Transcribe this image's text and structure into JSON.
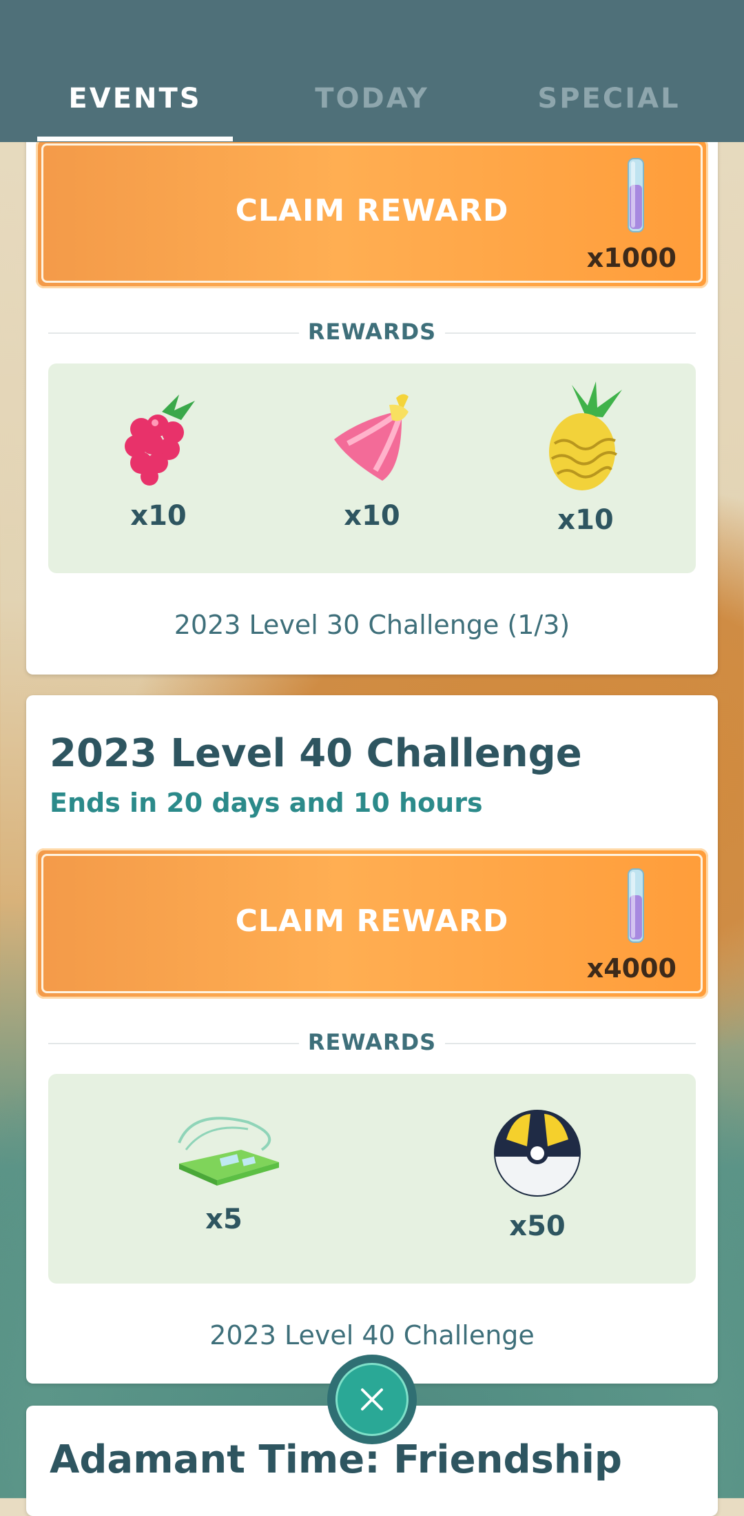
{
  "tabs": [
    {
      "label": "EVENTS",
      "active": true
    },
    {
      "label": "TODAY",
      "active": false
    },
    {
      "label": "SPECIAL",
      "active": false
    }
  ],
  "cards": [
    {
      "claim_label": "CLAIM REWARD",
      "claim_qty": "x1000",
      "rewards_heading": "REWARDS",
      "rewards": [
        {
          "icon": "razz-berry-icon",
          "qty": "x10"
        },
        {
          "icon": "nanab-berry-icon",
          "qty": "x10"
        },
        {
          "icon": "pinap-berry-icon",
          "qty": "x10"
        }
      ],
      "footer": "2023 Level 30 Challenge (1/3)"
    },
    {
      "title": "2023 Level 40 Challenge",
      "subtitle": "Ends in 20 days and 10 hours",
      "claim_label": "CLAIM REWARD",
      "claim_qty": "x4000",
      "rewards_heading": "REWARDS",
      "rewards": [
        {
          "icon": "raid-pass-icon",
          "qty": "x5"
        },
        {
          "icon": "ultra-ball-icon",
          "qty": "x50"
        }
      ],
      "footer": "2023 Level 40 Challenge"
    },
    {
      "title": "Adamant Time: Friendship"
    }
  ],
  "colors": {
    "header": "#4f7079",
    "claim_orange": "#ffae52",
    "reward_bg": "#e6f1e1",
    "accent_teal": "#2b8a8a"
  }
}
